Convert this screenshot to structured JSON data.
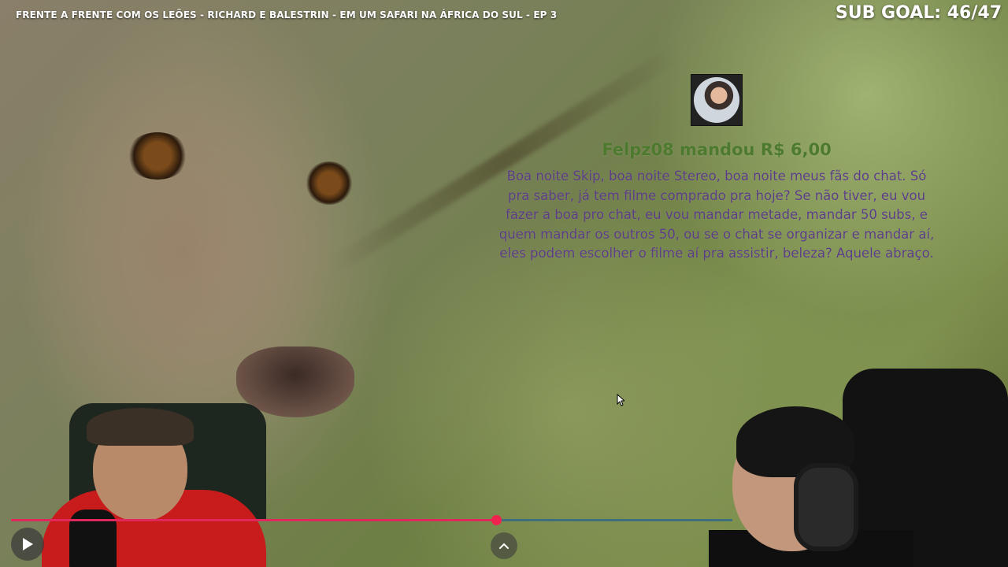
{
  "stream": {
    "title": "FRENTE A FRENTE COM OS LEÕES - RICHARD E BALESTRIN - EM UM SAFARI NA ÁFRICA DO SUL - EP 3",
    "sub_goal": "SUB GOAL: 46/47"
  },
  "donation": {
    "donor": "Felpz08",
    "action": "mandou",
    "amount": "R$ 6,00",
    "message": "Boa noite Skip, boa noite Stereo, boa noite meus fãs do chat. Só pra saber, já tem filme comprado pra hoje? Se não tiver, eu vou fazer a boa pro chat, eu vou mandar metade, mandar 50 subs, e quem mandar os outros 50, ou se o chat se organizar e mandar aí, eles podem escolher o filme aí pra assistir, beleza? Aquele abraço.",
    "colors": {
      "header": "#4d7a2f",
      "message": "#5b3d86"
    }
  },
  "player": {
    "progress": 0.665,
    "colors": {
      "played": "#e0285c",
      "rest": "#3f6f7d",
      "thumb": "#f0234e"
    },
    "icons": {
      "play": "play-icon",
      "expand": "chevron-up-icon"
    }
  }
}
